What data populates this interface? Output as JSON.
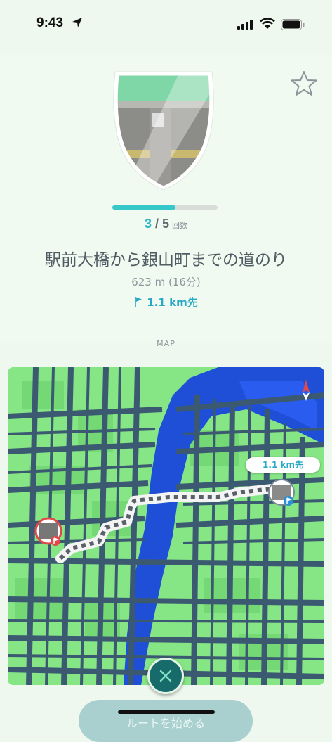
{
  "status_bar": {
    "time": "9:43"
  },
  "route": {
    "progress_current": "3",
    "progress_separator": "/",
    "progress_total": "5",
    "progress_unit": "回数",
    "progress_fraction": 0.6,
    "title": "駅前大橋から銀山町までの道のり",
    "distance": "623 m (16分)",
    "remaining": "1.1 km先"
  },
  "map": {
    "section_label": "MAP",
    "bubble_distance": "1.1 km先"
  },
  "footer": {
    "start_label": "ルートを始める"
  },
  "colors": {
    "accent": "#27b6c4",
    "progress": "#36c8c8",
    "map_green": "#7fe17f",
    "map_road": "#3b5a72",
    "river": "#1f4fd6",
    "close_button": "#186b6b"
  },
  "icons": [
    "location-arrow-icon",
    "signal-icon",
    "wifi-icon",
    "battery-icon",
    "star-icon",
    "flag-icon",
    "close-icon",
    "start-pin-icon",
    "end-pin-icon"
  ]
}
